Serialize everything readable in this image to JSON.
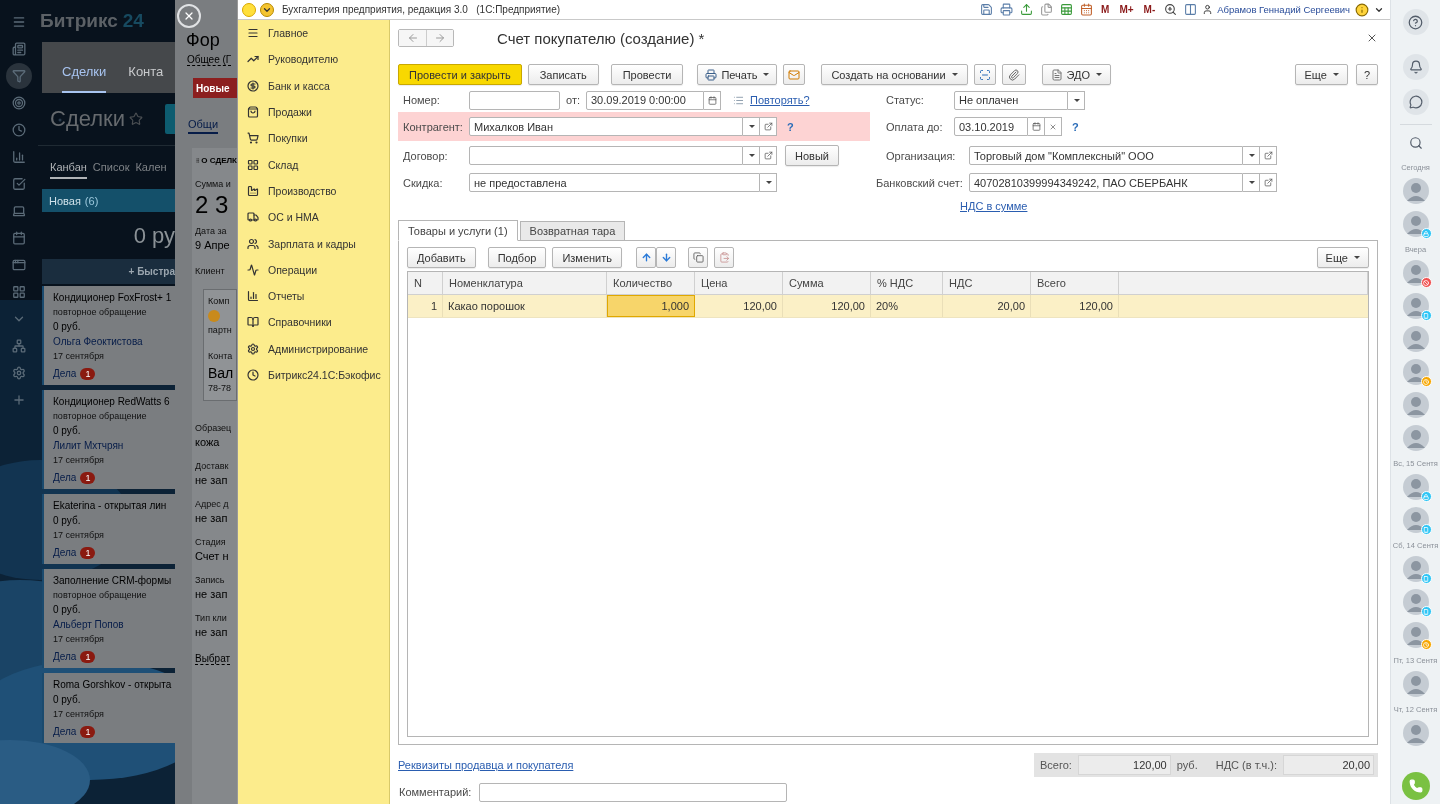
{
  "bitrix": {
    "logo": {
      "name": "Битрикс",
      "number": "24"
    },
    "tabs": [
      {
        "label": "Сделки",
        "selected": true
      },
      {
        "label": "Конта",
        "selected": false
      }
    ],
    "page_title": "Сделки",
    "views": [
      {
        "label": "Канбан",
        "selected": true
      },
      {
        "label": "Список",
        "selected": false
      },
      {
        "label": "Кален",
        "selected": false
      }
    ],
    "column": {
      "title": "Новая",
      "count": "(6)",
      "sum": "0 ру",
      "quick_add": "+ Быстра"
    },
    "cards": [
      {
        "title": "Кондиционер FoxFrost+ 1",
        "source": "повторное обращение",
        "amount": "0 руб.",
        "contact": "Ольга Феоктистова",
        "date": "17 сентября",
        "tasks": "Дела",
        "tasks_count": "1"
      },
      {
        "title": "Кондиционер RedWatts 6",
        "source": "повторное обращение",
        "amount": "0 руб.",
        "contact": "Лилит Мхтчрян",
        "date": "17 сентября",
        "tasks": "Дела",
        "tasks_count": "1"
      },
      {
        "title": "Ekaterina - открытая лин",
        "amount": "0 руб.",
        "date": "17 сентября",
        "tasks": "Дела",
        "tasks_count": "1"
      },
      {
        "title": "Заполнение CRM-формы",
        "source": "повторное обращение",
        "amount": "0 руб.",
        "contact": "Альберт Попов",
        "date": "17 сентября",
        "tasks": "Дела",
        "tasks_count": "1"
      },
      {
        "title": "Roma Gorshkov - открыта",
        "amount": "0 руб.",
        "date": "17 сентября",
        "tasks": "Дела",
        "tasks_count": "1"
      }
    ]
  },
  "deal_slider": {
    "title": "Фор",
    "category": "Общее (Г",
    "stage": "Новые",
    "tab": "Общи",
    "section": "О СДЕЛК",
    "amount": {
      "label": "Сумма и",
      "value": "2 3"
    },
    "close_date": {
      "label": "Дата за",
      "value": "9 Апре"
    },
    "client": {
      "label": "Клиент",
      "company_label": "Комп",
      "company_note": "партн",
      "contact_label": "Конта",
      "contact_name": "Вал",
      "contact_phone": "78-78"
    },
    "fields": [
      {
        "label": "Образец",
        "value": "кожа"
      },
      {
        "label": "Доставк",
        "value": "не зап"
      },
      {
        "label": "Адрес д",
        "value": "не зап"
      },
      {
        "label": "Стадия",
        "value": "Счет н"
      },
      {
        "label": "Запись",
        "value": "не зап"
      },
      {
        "label": "Тип кли",
        "value": "не зап"
      }
    ],
    "select_link": "Выбрат"
  },
  "onec": {
    "title": "Бухгалтерия предприятия, редакция 3.0",
    "subtitle": "(1С:Предприятие)",
    "memory": [
      "M",
      "M+",
      "M-"
    ],
    "user": "Абрамов Геннадий Сергеевич",
    "nav": [
      "Главное",
      "Руководителю",
      "Банк и касса",
      "Продажи",
      "Покупки",
      "Склад",
      "Производство",
      "ОС и НМА",
      "Зарплата и кадры",
      "Операции",
      "Отчеты",
      "Справочники",
      "Администрирование",
      "Битрикс24.1С:Бэкофис"
    ],
    "form": {
      "title": "Счет покупателю (создание) *",
      "buttons": {
        "post_close": "Провести и закрыть",
        "save": "Записать",
        "post": "Провести",
        "print": "Печать",
        "create_based": "Создать на основании",
        "edo": "ЭДО",
        "more": "Еще",
        "help": "?"
      },
      "number": {
        "label": "Номер:",
        "date_label": "от:",
        "date": "30.09.2019  0:00:00",
        "repeat_link": "Повторять?"
      },
      "counterparty": {
        "label": "Контрагент:",
        "value": "Михалков  Иван",
        "error": true,
        "help": "?"
      },
      "contract": {
        "label": "Договор:",
        "new_button": "Новый"
      },
      "discount": {
        "label": "Скидка:",
        "value": "не предоставлена"
      },
      "status": {
        "label": "Статус:",
        "value": "Не оплачен"
      },
      "pay_until": {
        "label": "Оплата до:",
        "value": "03.10.2019",
        "help": "?"
      },
      "organization": {
        "label": "Организация:",
        "value": "Торговый дом \"Комплексный\" ООО"
      },
      "bank_account": {
        "label": "Банковский счет:",
        "value": "40702810399994349242, ПАО СБЕРБАНК"
      },
      "vat_link": "НДС в сумме",
      "tabs": [
        {
          "label": "Товары и услуги (1)",
          "selected": true
        },
        {
          "label": "Возвратная тара",
          "selected": false
        }
      ],
      "table_buttons": [
        "Добавить",
        "Подбор",
        "Изменить"
      ],
      "table_more": "Еще",
      "columns": [
        "N",
        "Номенклатура",
        "Количество",
        "Цена",
        "Сумма",
        "% НДС",
        "НДС",
        "Всего"
      ],
      "rows": [
        {
          "selected": true,
          "cells": [
            {
              "text": "1",
              "active": false
            },
            {
              "text": "Какао порошок",
              "active": false
            },
            {
              "text": "1,000",
              "active": true
            },
            {
              "text": "120,00",
              "active": false
            },
            {
              "text": "120,00",
              "active": false
            },
            {
              "text": "20%",
              "active": false
            },
            {
              "text": "20,00",
              "active": false
            },
            {
              "text": "120,00",
              "active": false
            }
          ]
        }
      ],
      "details_link": "Реквизиты продавца и покупателя",
      "totals": {
        "total_label": "Всего:",
        "total": "120,00",
        "currency": "руб.",
        "vat_label": "НДС (в т.ч.):",
        "vat": "20,00"
      },
      "comment": {
        "label": "Комментарий:"
      }
    }
  },
  "right_panel": {
    "items": [
      {
        "kind": "label",
        "text": "Сегодня"
      },
      {
        "kind": "avatar"
      },
      {
        "kind": "avatar",
        "badge": {
          "kind": "lock",
          "color": "#2fc6f6"
        }
      },
      {
        "kind": "label",
        "text": "Вчера"
      },
      {
        "kind": "avatar",
        "badge": {
          "kind": "blocked",
          "color": "#f05050"
        }
      },
      {
        "kind": "avatar",
        "badge": {
          "kind": "mobile",
          "color": "#2fc6f6"
        }
      },
      {
        "kind": "avatar"
      },
      {
        "kind": "avatar",
        "badge": {
          "kind": "away",
          "color": "#f7a700"
        }
      },
      {
        "kind": "avatar"
      },
      {
        "kind": "avatar"
      },
      {
        "kind": "label",
        "text": "Вс, 15 Сентя"
      },
      {
        "kind": "avatar",
        "badge": {
          "kind": "lock",
          "color": "#2fc6f6"
        }
      },
      {
        "kind": "avatar",
        "badge": {
          "kind": "mobile",
          "color": "#2fc6f6"
        }
      },
      {
        "kind": "label",
        "text": "Сб, 14 Сентя"
      },
      {
        "kind": "avatar",
        "badge": {
          "kind": "mobile",
          "color": "#2fc6f6"
        }
      },
      {
        "kind": "avatar",
        "badge": {
          "kind": "mobile",
          "color": "#2fc6f6"
        }
      },
      {
        "kind": "avatar",
        "badge": {
          "kind": "away",
          "color": "#f7a700"
        }
      },
      {
        "kind": "label",
        "text": "Пт, 13 Сентя"
      },
      {
        "kind": "avatar"
      },
      {
        "kind": "label",
        "text": "Чт, 12 Сентя"
      },
      {
        "kind": "avatar"
      }
    ]
  }
}
